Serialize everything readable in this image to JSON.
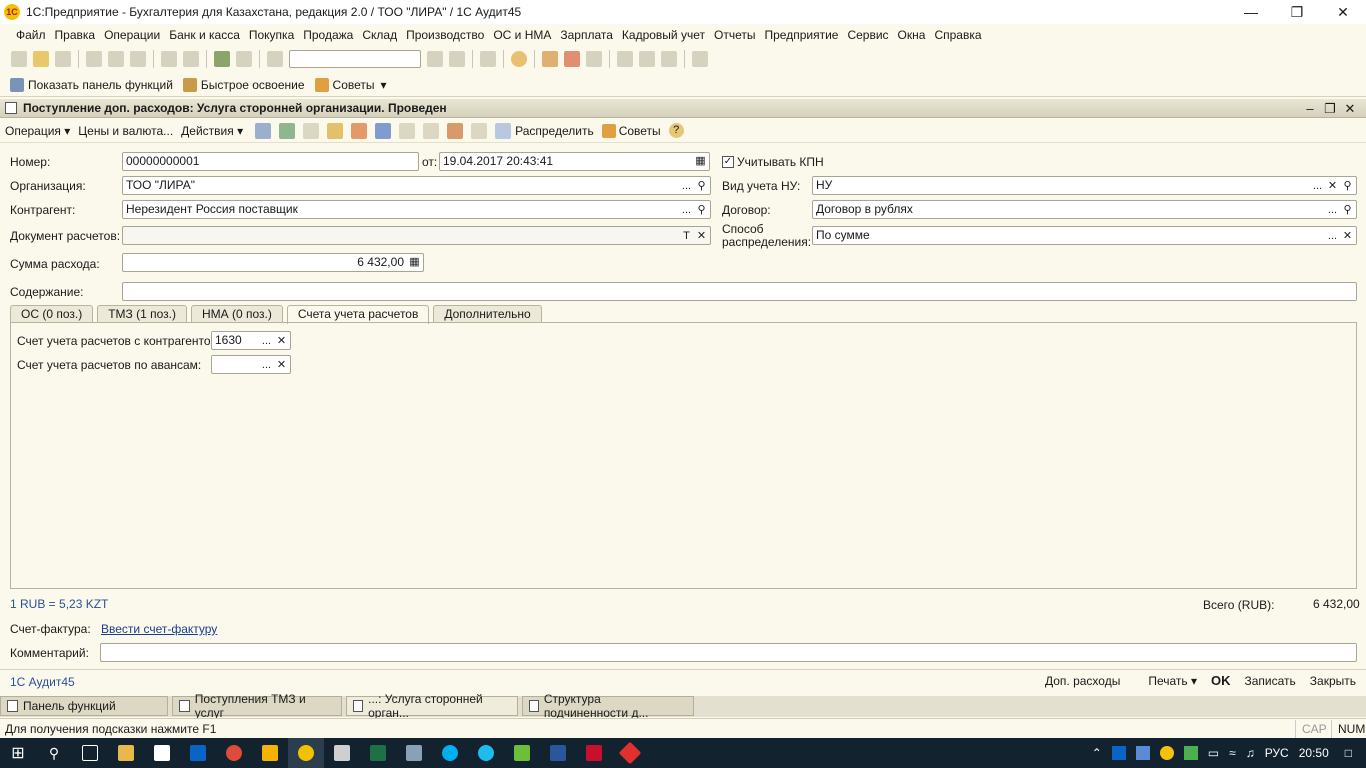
{
  "window": {
    "title": "1С:Предприятие - Бухгалтерия для Казахстана, редакция 2.0 / ТОО \"ЛИРА\" / 1С Аудит45",
    "app_icon": "1С"
  },
  "menu": [
    "Файл",
    "Правка",
    "Операции",
    "Банк и касса",
    "Покупка",
    "Продажа",
    "Склад",
    "Производство",
    "ОС и НМА",
    "Зарплата",
    "Кадровый учет",
    "Отчеты",
    "Предприятие",
    "Сервис",
    "Окна",
    "Справка"
  ],
  "toolbar2": {
    "show_panel": "Показать панель функций",
    "quick": "Быстрое освоение",
    "tips": "Советы"
  },
  "document": {
    "title": "Поступление доп. расходов: Услуга сторонней организации. Проведен",
    "cmd": {
      "operation": "Операция",
      "prices": "Цены и валюта...",
      "actions": "Действия",
      "distribute": "Распределить",
      "tips": "Советы",
      "help": "?"
    },
    "labels": {
      "number": "Номер:",
      "from": "от:",
      "org": "Организация:",
      "counterparty": "Контрагент:",
      "doc_settlements": "Документ расчетов:",
      "amount": "Сумма расхода:",
      "content": "Содержание:",
      "kpn": "Учитывать КПН",
      "nu_type": "Вид учета НУ:",
      "contract": "Договор:",
      "dist_method": "Способ распределения:"
    },
    "values": {
      "number": "00000000001",
      "date": "19.04.2017 20:43:41",
      "org": "ТОО \"ЛИРА\"",
      "counterparty": "Нерезидент Россия поставщик",
      "doc_settlements": "",
      "amount": "6 432,00",
      "content": "",
      "nu_type": "НУ",
      "contract": "Договор в рублях",
      "dist_method": "По сумме"
    },
    "tabs": [
      "ОС (0 поз.)",
      "ТМЗ (1 поз.)",
      "НМА (0 поз.)",
      "Счета учета расчетов",
      "Дополнительно"
    ],
    "accounts": {
      "with_counterparty_label": "Счет учета расчетов с контрагентом:",
      "with_counterparty": "1630",
      "advances_label": "Счет учета расчетов по авансам:",
      "advances": ""
    },
    "rate": "1 RUB = 5,23 KZT",
    "total_label": "Всего (RUB):",
    "total": "6 432,00",
    "invoice_label": "Счет-фактура:",
    "invoice_link": "Ввести счет-фактуру",
    "comment_label": "Комментарий:",
    "comment": "",
    "footer_left": "1С Аудит45",
    "footer": {
      "extra": "Доп. расходы",
      "print": "Печать",
      "ok": "OK",
      "save": "Записать",
      "close": "Закрыть"
    }
  },
  "window_tabs": [
    "Панель функций",
    "Поступления ТМЗ и услуг",
    "...: Услуга сторонней орган...",
    "Структура подчиненности д..."
  ],
  "status": {
    "hint": "Для получения подсказки нажмите F1",
    "cap": "CAP",
    "num": "NUM"
  },
  "tray": {
    "lang": "РУС",
    "time": "20:50"
  },
  "colors": {
    "bg": "#fbf9ec",
    "accent_blue": "#2a4f9c",
    "taskbar": "#12222e"
  }
}
